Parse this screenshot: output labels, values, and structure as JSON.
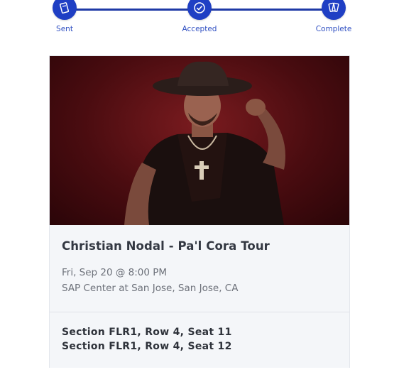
{
  "progress": {
    "steps": [
      {
        "label": "Sent",
        "icon": "ticket-icon"
      },
      {
        "label": "Accepted",
        "icon": "check-icon"
      },
      {
        "label": "Complete",
        "icon": "tickets-icon"
      }
    ],
    "accent_color": "#1f3fc4"
  },
  "event": {
    "title": "Christian Nodal - Pa'l Cora Tour",
    "date": "Fri, Sep 20 @ 8:00 PM",
    "venue": "SAP Center at San Jose, San Jose, CA"
  },
  "seats": [
    "Section FLR1, Row 4, Seat 11",
    "Section FLR1, Row 4, Seat 12"
  ]
}
